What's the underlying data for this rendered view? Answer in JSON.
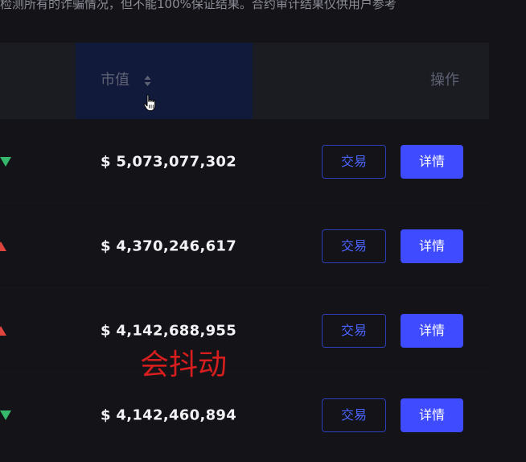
{
  "disclaimer": "检测所有的诈骗情况，但不能100%保证结果。合约审计结果仅供用户参考",
  "table": {
    "header": {
      "market_cap": "市值",
      "action": "操作"
    },
    "rows": [
      {
        "trend": "down",
        "market_cap": "$ 5,073,077,302",
        "trade": "交易",
        "detail": "详情"
      },
      {
        "trend": "up",
        "market_cap": "$ 4,370,246,617",
        "trade": "交易",
        "detail": "详情"
      },
      {
        "trend": "up",
        "market_cap": "$ 4,142,688,955",
        "trade": "交易",
        "detail": "详情"
      },
      {
        "trend": "down",
        "market_cap": "$ 4,142,460,894",
        "trade": "交易",
        "detail": "详情"
      }
    ]
  },
  "annotation": "会抖动",
  "icons": {
    "sort": "sort-icon",
    "cursor": "hand-pointer-icon",
    "trend_down": "triangle-down-icon",
    "trend_up": "triangle-up-icon"
  },
  "colors": {
    "background": "#131318",
    "header_bg": "#1b1b22",
    "highlight_column": "#121a3c",
    "primary_button": "#3f4bff",
    "outline_button_border": "#2d3fb8",
    "up": "#e0443f",
    "down": "#35b86b",
    "annotation": "#d71e1e"
  }
}
